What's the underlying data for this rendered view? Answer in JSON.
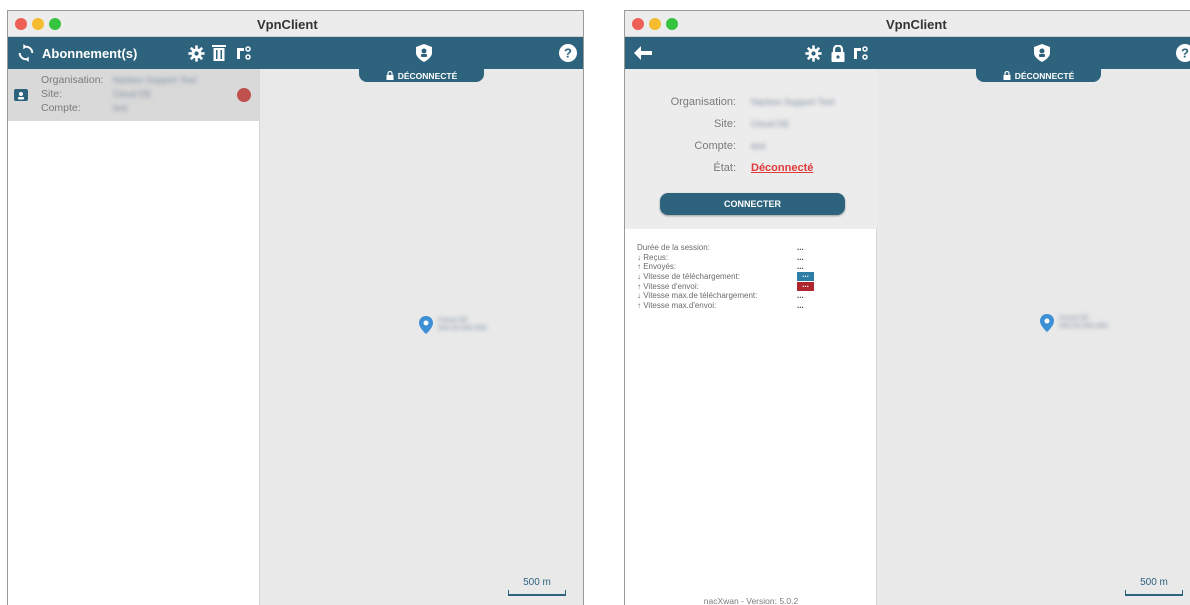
{
  "left": {
    "title": "VpnClient",
    "toolbar_title": "Abonnement(s)",
    "subscription": {
      "org_label": "Organisation:",
      "org_value": "Nacbox Support Tool",
      "site_label": "Site:",
      "site_value": "Cloud DE",
      "account_label": "Compte:",
      "account_value": "test"
    },
    "status_label": "DÉCONNECTÉ",
    "map_pin_line1": "Cloud DE",
    "map_pin_line2": "000.00.000.000",
    "scale_label": "500 m"
  },
  "right": {
    "title": "VpnClient",
    "details": {
      "org_label": "Organisation:",
      "org_value": "Nacbox Support Tool",
      "site_label": "Site:",
      "site_value": "Cloud DE",
      "account_label": "Compte:",
      "account_value": "test",
      "state_label": "État:",
      "state_value": "Déconnecté"
    },
    "connect_label": "CONNECTER",
    "stats": [
      {
        "label": "Durée de la session:",
        "value": "..."
      },
      {
        "label": "↓ Reçus:",
        "value": "..."
      },
      {
        "label": "↑ Envoyés:",
        "value": "..."
      },
      {
        "label": "↓ Vitesse de téléchargement:",
        "value": "..."
      },
      {
        "label": "↑ Vitesse d'envoi:",
        "value": "..."
      },
      {
        "label": "↓ Vitesse max.de téléchargement:",
        "value": "..."
      },
      {
        "label": "↑ Vitesse max.d'envoi:",
        "value": "..."
      }
    ],
    "version": "nacXwan - Version: 5.0.2",
    "status_label": "DÉCONNECTÉ",
    "map_pin_line1": "Cloud DE",
    "map_pin_line2": "000.00.000.000",
    "scale_label": "500 m"
  },
  "colors": {
    "toolbar": "#2d637d",
    "disconnected_red": "#e03a3a",
    "status_dot": "#c0504d",
    "download_badge": "#2d7ea6",
    "upload_badge": "#b0262e"
  }
}
